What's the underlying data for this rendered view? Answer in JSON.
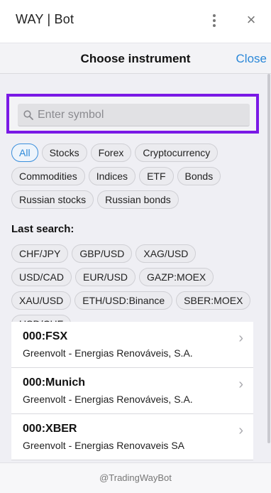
{
  "window": {
    "title": "WAY | Bot",
    "menu_icon": "kebab-menu-icon",
    "close_glyph": "×"
  },
  "sheet": {
    "title": "Choose instrument",
    "close_label": "Close"
  },
  "search": {
    "placeholder": "Enter symbol",
    "value": "",
    "highlight_color": "#7a19e6"
  },
  "categories": [
    {
      "label": "All",
      "active": true
    },
    {
      "label": "Stocks",
      "active": false
    },
    {
      "label": "Forex",
      "active": false
    },
    {
      "label": "Cryptocurrency",
      "active": false
    },
    {
      "label": "Commodities",
      "active": false
    },
    {
      "label": "Indices",
      "active": false
    },
    {
      "label": "ETF",
      "active": false
    },
    {
      "label": "Bonds",
      "active": false
    },
    {
      "label": "Russian stocks",
      "active": false
    },
    {
      "label": "Russian bonds",
      "active": false
    }
  ],
  "last_search": {
    "label": "Last search:",
    "items": [
      "CHF/JPY",
      "GBP/USD",
      "XAG/USD",
      "USD/CAD",
      "EUR/USD",
      "GAZP:MOEX",
      "XAU/USD",
      "ETH/USD:Binance",
      "SBER:MOEX",
      "USD/CHF"
    ]
  },
  "instruments": [
    {
      "symbol": "000:FSX",
      "name": "Greenvolt - Energias Renováveis, S.A."
    },
    {
      "symbol": "000:Munich",
      "name": "Greenvolt - Energias Renováveis, S.A."
    },
    {
      "symbol": "000:XBER",
      "name": "Greenvolt - Energias Renovaveis SA"
    }
  ],
  "footer": {
    "text": "@TradingWayBot"
  },
  "colors": {
    "accent": "#2b88d8",
    "highlight": "#7a19e6"
  }
}
